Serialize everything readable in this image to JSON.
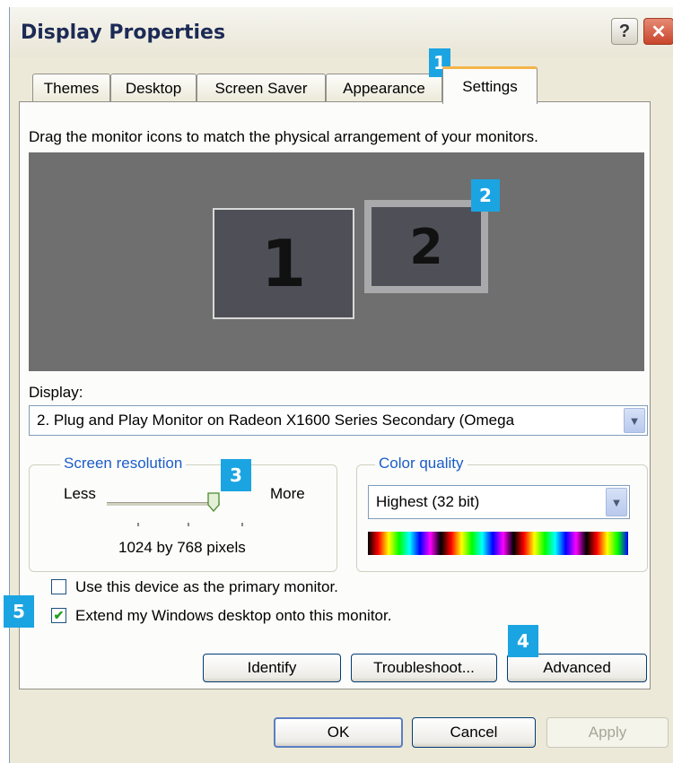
{
  "window": {
    "title": "Display Properties",
    "help_label": "?",
    "close_label": "✕"
  },
  "tabs": [
    {
      "label": "Themes"
    },
    {
      "label": "Desktop"
    },
    {
      "label": "Screen Saver"
    },
    {
      "label": "Appearance"
    },
    {
      "label": "Settings",
      "active": true
    }
  ],
  "settings": {
    "instruction": "Drag the monitor icons to match the physical arrangement of your monitors.",
    "monitors": [
      {
        "number": "1"
      },
      {
        "number": "2",
        "selected": true
      }
    ],
    "display_label": "Display:",
    "display_value": "2. Plug and Play Monitor on Radeon X1600 Series Secondary (Omega",
    "resolution": {
      "legend": "Screen resolution",
      "less": "Less",
      "more": "More",
      "value": "1024 by 768 pixels",
      "slider_level": 1.0
    },
    "color_quality": {
      "legend": "Color quality",
      "value": "Highest (32 bit)"
    },
    "primary_checkbox": {
      "label": "Use this device as the primary monitor.",
      "checked": false
    },
    "extend_checkbox": {
      "label": "Extend my Windows desktop onto this monitor.",
      "checked": true
    },
    "buttons": {
      "identify": "Identify",
      "troubleshoot": "Troubleshoot...",
      "advanced": "Advanced"
    }
  },
  "footer": {
    "ok": "OK",
    "cancel": "Cancel",
    "apply": "Apply"
  },
  "callouts": [
    "1",
    "2",
    "3",
    "4",
    "5"
  ],
  "colors": {
    "callout": "#1ba4e2",
    "active_tab_accent": "#f3b54a",
    "legend_text": "#1b5dc8"
  }
}
